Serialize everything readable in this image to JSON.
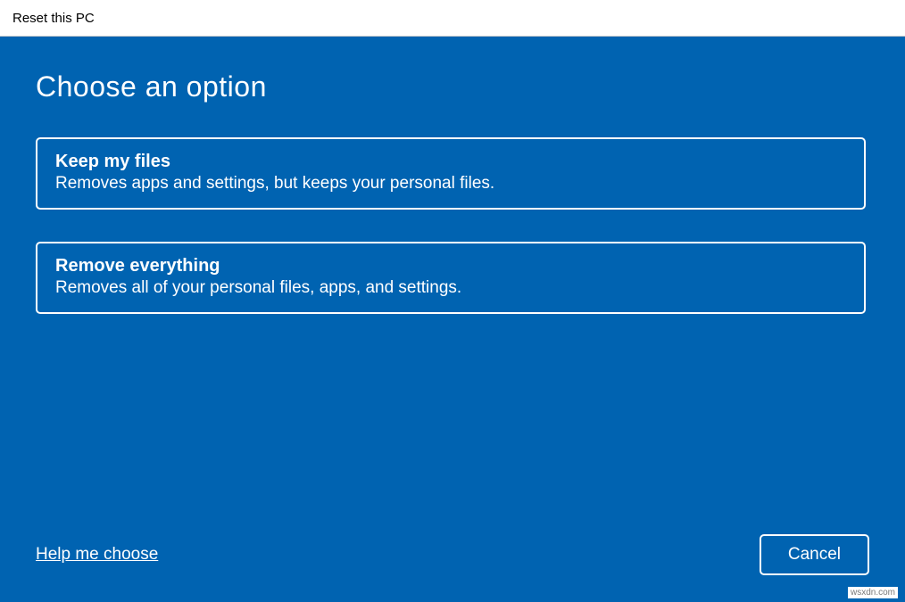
{
  "window": {
    "title": "Reset this PC"
  },
  "page": {
    "heading": "Choose an option"
  },
  "options": {
    "keep": {
      "title": "Keep my files",
      "description": "Removes apps and settings, but keeps your personal files."
    },
    "remove": {
      "title": "Remove everything",
      "description": "Removes all of your personal files, apps, and settings."
    }
  },
  "footer": {
    "help_link": "Help me choose",
    "cancel": "Cancel"
  },
  "watermark": "wsxdn.com"
}
